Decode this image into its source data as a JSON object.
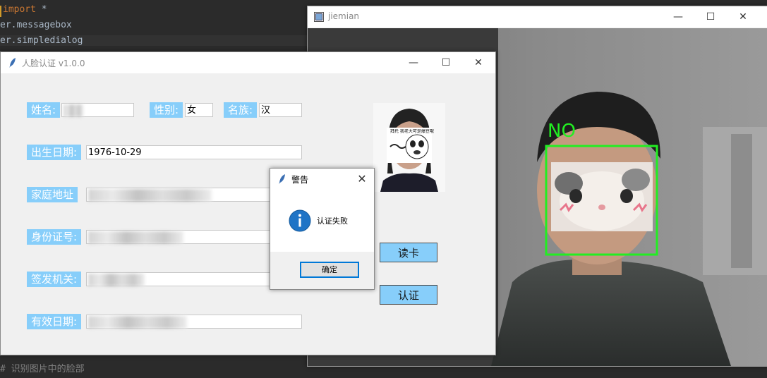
{
  "editor": {
    "line1_kw": "import",
    "line1_rest": " *",
    "line2": "er.messagebox",
    "line3": "er.simpledialog",
    "line_bottom": "# 识别图片中的脸部"
  },
  "camera_window": {
    "title": "jiemian",
    "detection_label": "NO",
    "detection_color": "#22ee22"
  },
  "main_window": {
    "title": "人脸认证 v1.0.0",
    "fields": {
      "name_label": "姓名:",
      "gender_label": "性别:",
      "gender_value": "女",
      "ethnicity_label": "名族:",
      "ethnicity_value": "汉",
      "birth_label": "出生日期:",
      "birth_value": "1976-10-29",
      "address_label": "家庭地址",
      "id_label": "身份证号:",
      "issuer_label": "签发机关:",
      "valid_label": "有效日期:"
    },
    "sticker_text": "拜托 我老大可是爆豆哦",
    "read_card_button": "读卡",
    "verify_button": "认证",
    "label_bg_color": "#87cefa"
  },
  "dialog": {
    "title": "警告",
    "message": "认证失败",
    "ok_button": "确定",
    "icon": "info-icon"
  }
}
